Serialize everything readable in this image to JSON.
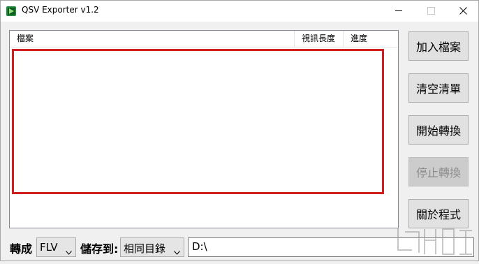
{
  "window": {
    "title": "QSV Exporter v1.2"
  },
  "list": {
    "columns": [
      "檔案",
      "視訊長度",
      "進度"
    ],
    "rows": []
  },
  "buttons": {
    "add_file": "加入檔案",
    "clear_list": "清空清單",
    "start_convert": "開始轉換",
    "stop_convert": "停止轉換",
    "about": "關於程式"
  },
  "bottom": {
    "convert_label": "轉成",
    "format_value": "FLV",
    "save_to_label": "儲存到:",
    "save_location_value": "相同目錄",
    "path_value": "D:\\"
  },
  "colors": {
    "highlight": "#d01e1e",
    "disabled_text": "#8d8d8d"
  }
}
